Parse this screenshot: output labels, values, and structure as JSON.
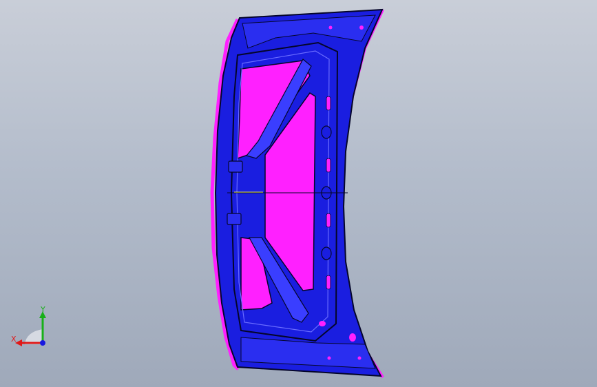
{
  "viewport": {
    "background_top": "#c9ced8",
    "background_bottom": "#9fa9ba"
  },
  "model": {
    "colors": {
      "inner_panel_blue": "#1a1ee0",
      "outer_skin_magenta": "#ff20ff",
      "edge_lines": "#05062a",
      "highlight_blue": "#6a6cff"
    }
  },
  "triad": {
    "x_label": "X",
    "y_label": "Y",
    "x_color": "#e01818",
    "y_color": "#18b018",
    "z_color": "#1818e0"
  }
}
